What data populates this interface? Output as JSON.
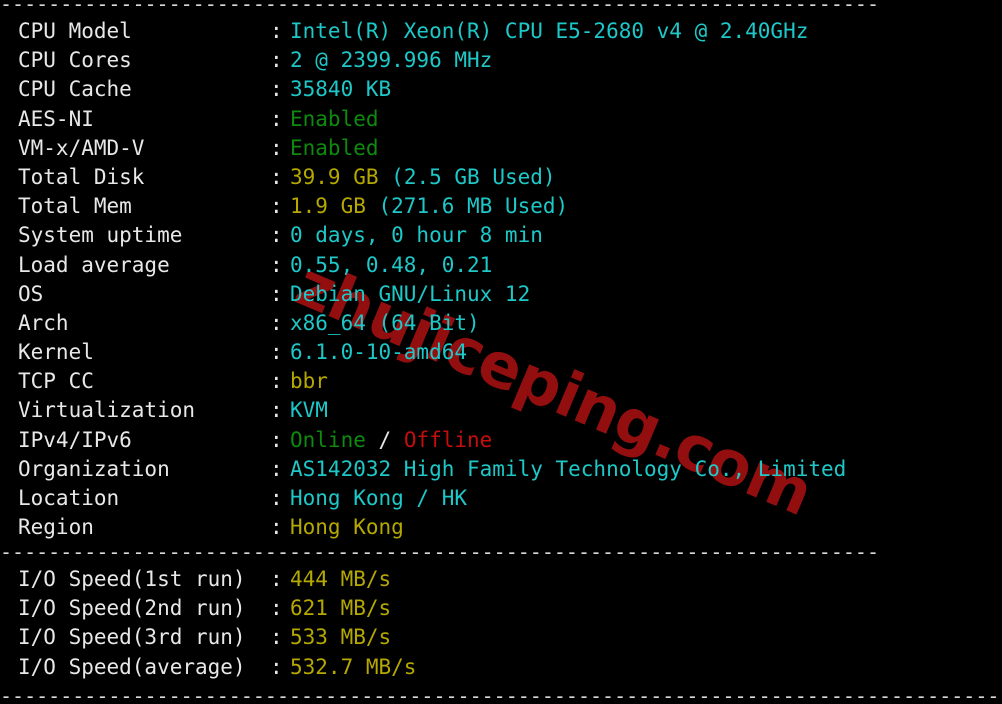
{
  "terminal": {
    "background": "#000000",
    "default_text_color": "#e8e8e8",
    "colors": {
      "cyan": "#1ec8c8",
      "yellow": "#b5a800",
      "green": "#0e8a0e",
      "red": "#c40d0d",
      "white": "#e8e8e8",
      "watermark_red": "#930f0f"
    }
  },
  "watermark": {
    "text": "zhujiceping.com"
  },
  "separators": {
    "top": "-------------------------------------------------------------------------",
    "middle": "-------------------------------------------------------------------------",
    "bottom": "-----------------------------------------------------------------------------------"
  },
  "colon": ":",
  "system_info": {
    "rows": [
      {
        "label": "CPU Model",
        "value": "Intel(R) Xeon(R) CPU E5-2680 v4 @ 2.40GHz",
        "color": "cyan"
      },
      {
        "label": "CPU Cores",
        "value": "2 @ 2399.996 MHz",
        "color": "cyan"
      },
      {
        "label": "CPU Cache",
        "value": "35840 KB",
        "color": "cyan"
      },
      {
        "label": "AES-NI",
        "value": "Enabled",
        "color": "green"
      },
      {
        "label": "VM-x/AMD-V",
        "value": "Enabled",
        "color": "green"
      },
      {
        "label": "Total Disk",
        "value": "39.9 GB (2.5 GB Used)",
        "color": "split_disk"
      },
      {
        "label": "Total Mem",
        "value": "1.9 GB (271.6 MB Used)",
        "color": "split_mem"
      },
      {
        "label": "System uptime",
        "value": "0 days, 0 hour 8 min",
        "color": "cyan"
      },
      {
        "label": "Load average",
        "value": "0.55, 0.48, 0.21",
        "color": "cyan"
      },
      {
        "label": "OS",
        "value": "Debian GNU/Linux 12",
        "color": "cyan"
      },
      {
        "label": "Arch",
        "value": "x86_64 (64 Bit)",
        "color": "cyan"
      },
      {
        "label": "Kernel",
        "value": "6.1.0-10-amd64",
        "color": "cyan"
      },
      {
        "label": "TCP CC",
        "value": "bbr",
        "color": "yellow"
      },
      {
        "label": "Virtualization",
        "value": "KVM",
        "color": "cyan"
      },
      {
        "label": "IPv4/IPv6",
        "value": "Online / Offline",
        "color": "split_net"
      },
      {
        "label": "Organization",
        "value": "AS142032 High Family Technology Co., Limited",
        "color": "cyan"
      },
      {
        "label": "Location",
        "value": "Hong Kong / HK",
        "color": "cyan"
      },
      {
        "label": "Region",
        "value": "Hong Kong",
        "color": "yellow"
      }
    ],
    "disk": {
      "size": "39.9 GB",
      "used": "(2.5 GB Used)"
    },
    "mem": {
      "size": "1.9 GB",
      "used": "(271.6 MB Used)"
    },
    "net": {
      "ipv4": "Online",
      "slash": "/",
      "ipv6": "Offline"
    }
  },
  "io_speed": {
    "rows": [
      {
        "label": "I/O Speed(1st run)",
        "value": "444 MB/s"
      },
      {
        "label": "I/O Speed(2nd run)",
        "value": "621 MB/s"
      },
      {
        "label": "I/O Speed(3rd run)",
        "value": "533 MB/s"
      },
      {
        "label": "I/O Speed(average)",
        "value": "532.7 MB/s"
      }
    ]
  }
}
